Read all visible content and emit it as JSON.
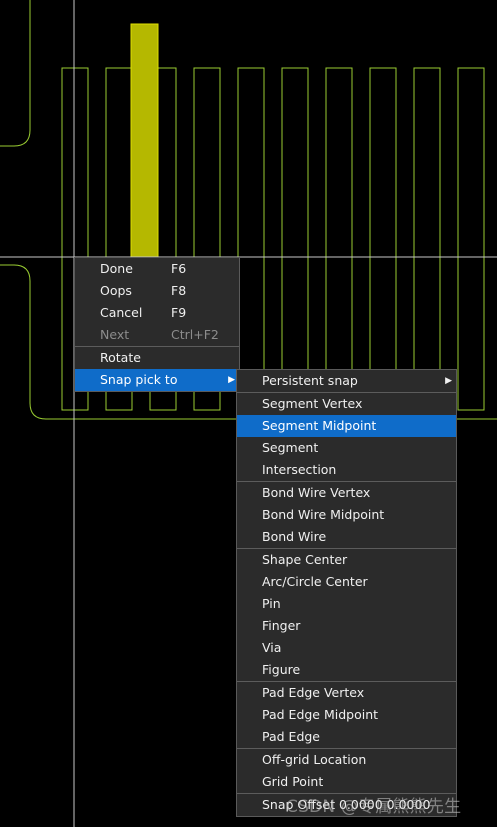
{
  "context_menu": {
    "items": [
      {
        "label": "Done",
        "shortcut": "F6",
        "enabled": true
      },
      {
        "label": "Oops",
        "shortcut": "F8",
        "enabled": true
      },
      {
        "label": "Cancel",
        "shortcut": "F9",
        "enabled": true
      },
      {
        "label": "Next",
        "shortcut": "Ctrl+F2",
        "enabled": false
      },
      {
        "label": "Rotate"
      },
      {
        "label": "Snap pick to",
        "has_submenu": true,
        "highlighted": true
      }
    ]
  },
  "snap_submenu": {
    "items": [
      {
        "label": "Persistent snap",
        "has_submenu": true
      },
      {
        "label": "Segment Vertex"
      },
      {
        "label": "Segment Midpoint",
        "highlighted": true
      },
      {
        "label": "Segment"
      },
      {
        "label": "Intersection"
      },
      {
        "label": "Bond Wire Vertex"
      },
      {
        "label": "Bond Wire Midpoint"
      },
      {
        "label": "Bond Wire"
      },
      {
        "label": "Shape Center"
      },
      {
        "label": "Arc/Circle Center"
      },
      {
        "label": "Pin"
      },
      {
        "label": "Finger"
      },
      {
        "label": "Via"
      },
      {
        "label": "Figure"
      },
      {
        "label": "Pad Edge Vertex"
      },
      {
        "label": "Pad Edge Midpoint"
      },
      {
        "label": "Pad Edge"
      },
      {
        "label": "Off-grid Location"
      },
      {
        "label": "Grid Point"
      },
      {
        "label": "Snap Offset 0.0000 0.0000"
      }
    ]
  },
  "watermark": "CSDN @专属熊熊先生",
  "colors": {
    "outline": "#9acd32",
    "selected_fill": "#b5b800",
    "crosshair": "#c8c8c8",
    "menu_bg": "#2b2b2b",
    "highlight": "#0f6cc9"
  }
}
